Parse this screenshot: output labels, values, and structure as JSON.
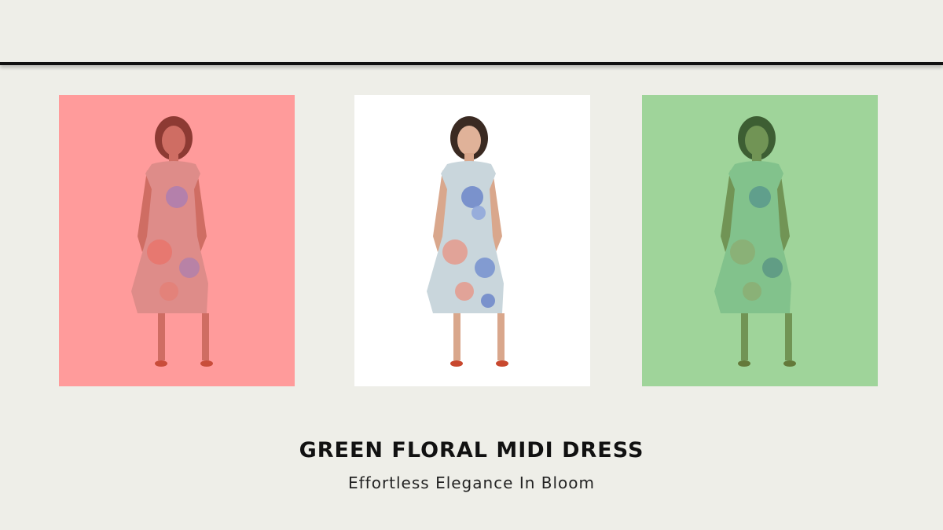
{
  "product": {
    "title": "GREEN FLORAL MIDI DRESS",
    "tagline": "Effortless Elegance In Bloom"
  },
  "panels": [
    {
      "name": "red-tint",
      "background": "#ff9b9b",
      "tint": "#ff3b3b"
    },
    {
      "name": "original",
      "background": "#ffffff",
      "tint": "none"
    },
    {
      "name": "green-tint",
      "background": "#9fd49a",
      "tint": "#3c9a3c"
    }
  ],
  "colors": {
    "page_background": "#eeeee8",
    "rule": "#111111",
    "dress_base": "#c9d6dc",
    "dress_floral_blue": "#6c86c9",
    "dress_floral_pink": "#e59a8c",
    "skin": "#d9a78c",
    "hair": "#3a2a22",
    "shoes": "#c8482e"
  },
  "icons": [
    "model-figure-icon"
  ]
}
